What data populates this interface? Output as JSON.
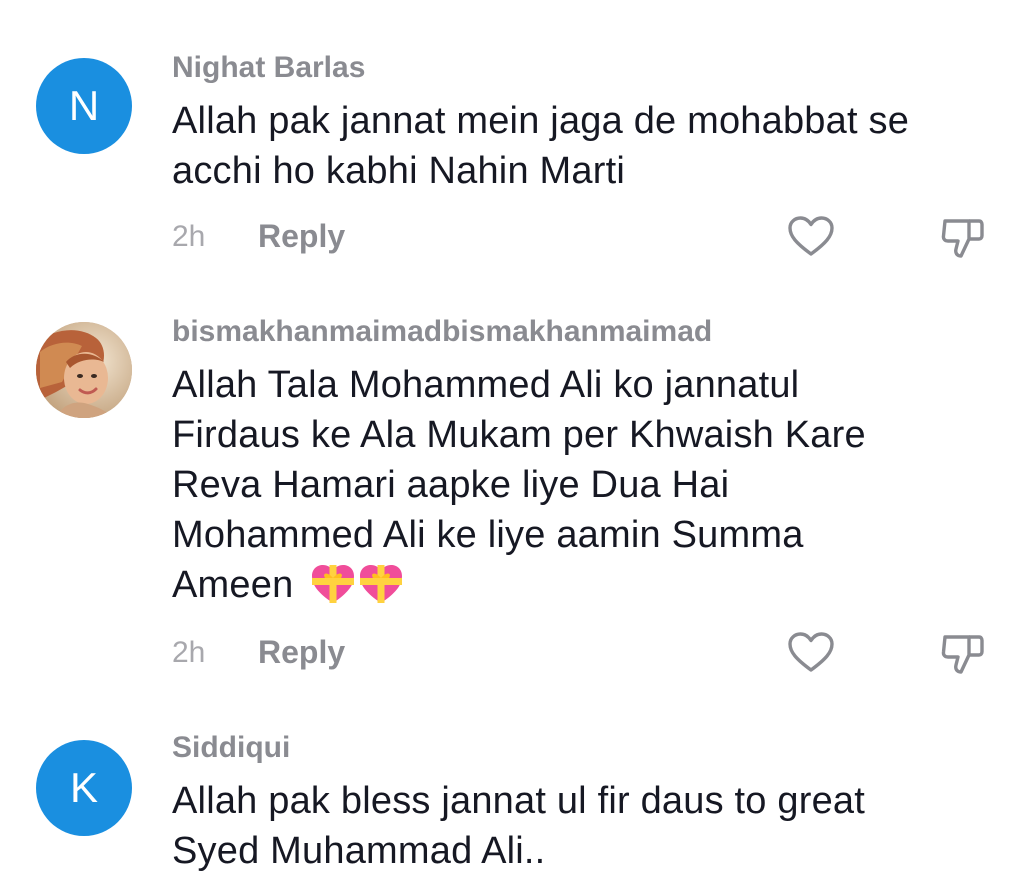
{
  "comments": [
    {
      "username": "Nighat Barlas",
      "avatar_letter": "N",
      "avatar_color": "#1a8fe0",
      "text_lines": [
        "Allah pak jannat mein jaga de mohabbat se",
        "acchi ho kabhi Nahin Marti"
      ],
      "time": "2h",
      "reply_label": "Reply"
    },
    {
      "username": "bismakhanmaimadbismakhanmaimad",
      "avatar_type": "photo",
      "text_lines": [
        "Allah Tala Mohammed Ali ko jannatul",
        "Firdaus ke Ala Mukam per Khwaish Kare",
        "Reva Hamari aapke liye Dua Hai",
        "Mohammed Ali ke liye aamin Summa",
        "Ameen"
      ],
      "emoji": [
        "heart-with-ribbon",
        "heart-with-ribbon"
      ],
      "time": "2h",
      "reply_label": "Reply"
    },
    {
      "username": "Siddiqui",
      "avatar_letter": "K",
      "avatar_color": "#1a8fe0",
      "text_lines": [
        "Allah pak bless jannat ul fir daus to great",
        "Syed Muhammad Ali.."
      ]
    }
  ],
  "icons": {
    "like": "heart-outline-icon",
    "dislike": "thumbs-down-outline-icon"
  }
}
